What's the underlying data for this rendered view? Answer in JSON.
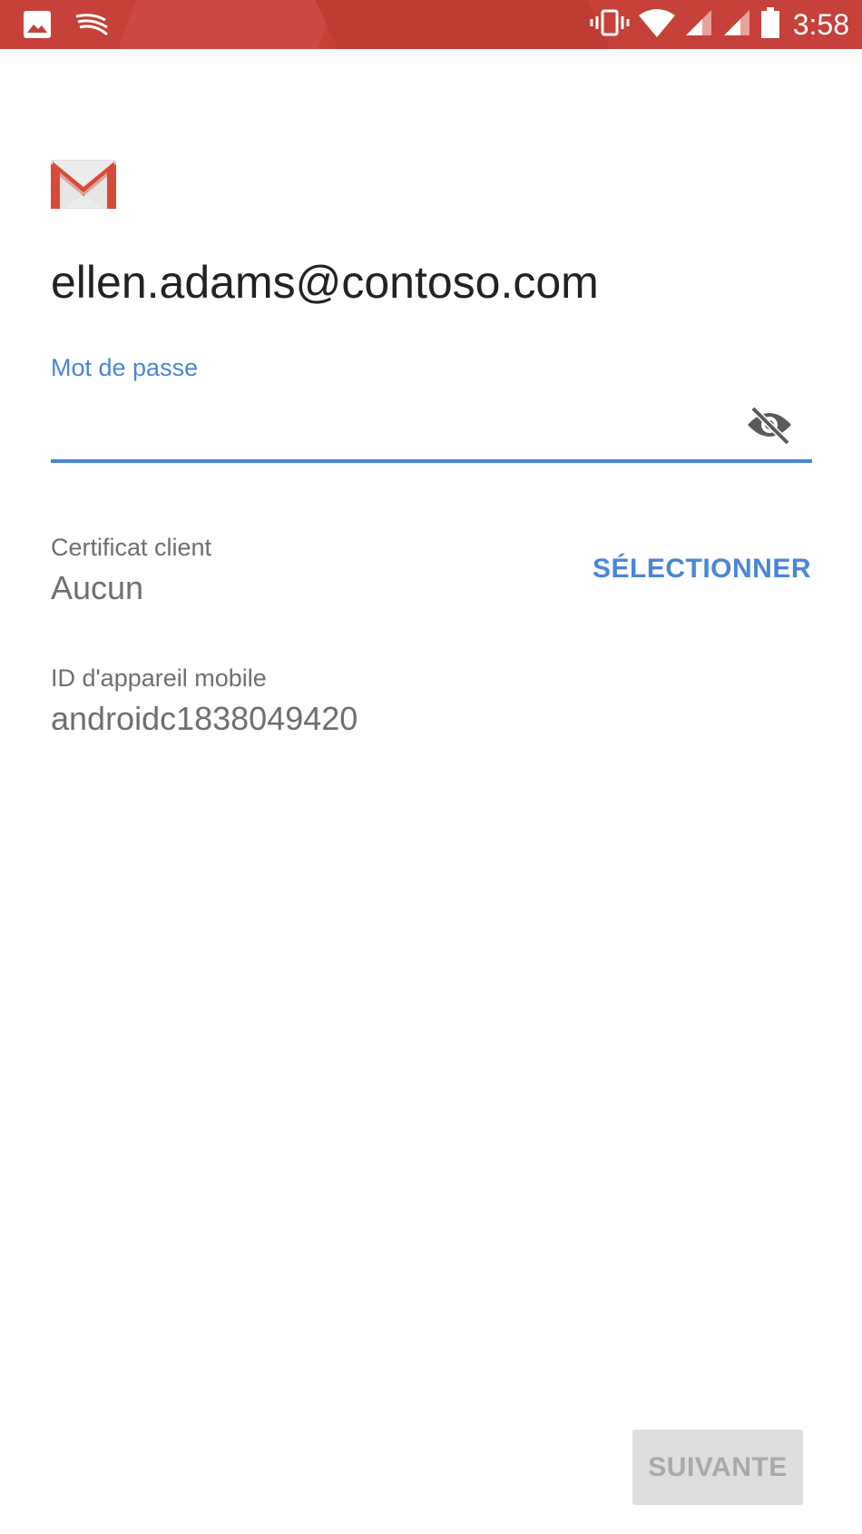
{
  "status_bar": {
    "time": "3:58",
    "icons": [
      "image-icon",
      "swiftkey-icon",
      "vibrate-icon",
      "wifi-icon",
      "signal-icon",
      "signal-icon",
      "battery-icon"
    ]
  },
  "account": {
    "email": "ellen.adams@contoso.com"
  },
  "password": {
    "label": "Mot de passe",
    "value": "",
    "toggle_icon": "visibility-off-icon"
  },
  "certificate": {
    "label": "Certificat client",
    "value": "Aucun",
    "select_label": "SÉLECTIONNER"
  },
  "device": {
    "label": "ID d'appareil mobile",
    "value": "androidc1838049420"
  },
  "footer": {
    "next_label": "SUIVANTE"
  },
  "colors": {
    "status_bar": "#c5413a",
    "accent": "#4a86d8",
    "secondary_text": "#6f6f6f",
    "disabled_button": "#dedede"
  }
}
